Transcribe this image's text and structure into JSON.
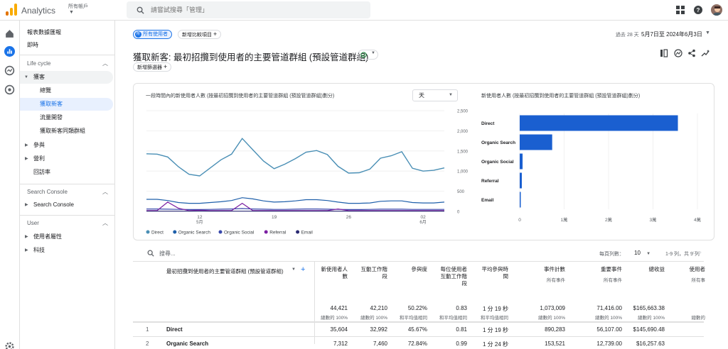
{
  "app": {
    "name": "Analytics",
    "account_label": "所有帳戶",
    "search_placeholder": "請嘗試搜尋「管理」"
  },
  "nav": {
    "items": [
      {
        "label": "報表數據匯報"
      },
      {
        "label": "即時"
      }
    ],
    "lifecycle": {
      "title": "Life cycle",
      "acquisition": "獲客",
      "acq_children": [
        "總覽",
        "獲取新客",
        "流量開發",
        "獲取新客同類群組"
      ],
      "engagement": "參與",
      "monetization": "營利",
      "retention": "回訪率"
    },
    "search_console": {
      "title": "Search Console",
      "item": "Search Console"
    },
    "user": {
      "title": "User",
      "items": [
        "使用者屬性",
        "科技"
      ]
    }
  },
  "toolbar": {
    "segment_chip": "所有使用者",
    "segment_avatar": "所",
    "add_compare": "新增比較項目",
    "add_filter": "新增篩選器",
    "date_label": "過去 28 天",
    "date_range": "5月7日至 2024年6月3日"
  },
  "page_title": "獲取新客: 最初招攬到使用者的主要管道群組 (預設管道群組)",
  "line_chart": {
    "title": "一段時間內的新使用者人數 (按最初招攬到使用者的主要管道群組 (預設管道群組)劃分)",
    "granularity": "天",
    "legend": [
      {
        "name": "Direct",
        "color": "#4a8fb5"
      },
      {
        "name": "Organic Search",
        "color": "#1e5faa"
      },
      {
        "name": "Organic Social",
        "color": "#3949ab"
      },
      {
        "name": "Referral",
        "color": "#7b1fa2"
      },
      {
        "name": "Email",
        "color": "#2a2a72"
      }
    ]
  },
  "bar_chart": {
    "title": "新使用者人數 (按最初招攬到使用者的主要管道群組 (預設管道群組)劃分)",
    "bar_color": "#1a5fd0"
  },
  "chart_data": [
    {
      "type": "line",
      "x_ticks": [
        {
          "label": "12",
          "sub": "5月"
        },
        {
          "label": "19",
          "sub": ""
        },
        {
          "label": "26",
          "sub": ""
        },
        {
          "label": "02",
          "sub": "6月"
        }
      ],
      "y_ticks": [
        "2,500",
        "2,000",
        "1,500",
        "1,000",
        "500",
        "0"
      ],
      "ylim": [
        0,
        2500
      ],
      "series": [
        {
          "name": "Direct",
          "values": [
            1430,
            1420,
            1350,
            1110,
            920,
            880,
            1080,
            1280,
            1420,
            1810,
            1530,
            1250,
            1060,
            1170,
            1310,
            1470,
            1510,
            1410,
            1120,
            950,
            960,
            1050,
            1320,
            1380,
            1480,
            1070,
            1000,
            1020,
            1080
          ]
        },
        {
          "name": "Organic Search",
          "values": [
            300,
            300,
            270,
            220,
            200,
            200,
            220,
            240,
            270,
            340,
            310,
            260,
            230,
            240,
            260,
            290,
            290,
            270,
            230,
            200,
            200,
            210,
            250,
            260,
            260,
            220,
            210,
            210,
            230
          ]
        },
        {
          "name": "Organic Social",
          "values": [
            60,
            60,
            55,
            50,
            45,
            45,
            50,
            55,
            60,
            70,
            60,
            55,
            50,
            50,
            55,
            60,
            60,
            55,
            50,
            45,
            45,
            50,
            55,
            55,
            55,
            50,
            50,
            50,
            50
          ]
        },
        {
          "name": "Referral",
          "values": [
            20,
            20,
            230,
            80,
            20,
            30,
            20,
            20,
            20,
            200,
            20,
            20,
            20,
            20,
            20,
            20,
            20,
            20,
            60,
            20,
            20,
            20,
            20,
            20,
            20,
            20,
            20,
            20,
            20
          ]
        },
        {
          "name": "Email",
          "values": [
            5,
            5,
            5,
            5,
            5,
            5,
            5,
            5,
            5,
            5,
            5,
            5,
            5,
            5,
            5,
            5,
            5,
            5,
            5,
            5,
            5,
            5,
            5,
            5,
            5,
            5,
            5,
            5,
            5
          ]
        }
      ]
    },
    {
      "type": "bar",
      "orientation": "horizontal",
      "categories": [
        "Direct",
        "Organic Search",
        "Organic Social",
        "Referral",
        "Email"
      ],
      "values": [
        35604,
        7312,
        650,
        480,
        240
      ],
      "x_ticks": [
        "0",
        "1萬",
        "2萬",
        "3萬",
        "4萬"
      ],
      "xlim": [
        0,
        40000
      ]
    }
  ],
  "table": {
    "search_placeholder": "搜尋...",
    "rows_per_page_label": "每頁列數：",
    "rows_per_page": "10",
    "pagination": "1-9 列，共 9 列",
    "dimension_header": "最初招攬到使用者的主要管道群組 (預設管道群組)",
    "columns": [
      {
        "header": "新使用者人數",
        "sub": "",
        "total": "44,421",
        "total_sub": "總數的 100%"
      },
      {
        "header": "互動工作階段",
        "sub": "",
        "total": "42,210",
        "total_sub": "總數的 100%"
      },
      {
        "header": "參與度",
        "sub": "",
        "total": "50.22%",
        "total_sub": "和平均值相同"
      },
      {
        "header": "每位使用者互動工作階段",
        "sub": "",
        "total": "0.83",
        "total_sub": "和平均值相同"
      },
      {
        "header": "平均參與時間",
        "sub": "",
        "total": "1 分 19 秒",
        "total_sub": "和平均值相同"
      },
      {
        "header": "事件計數",
        "sub": "所有事件",
        "total": "1,073,009",
        "total_sub": "總數的 100%"
      },
      {
        "header": "重要事件",
        "sub": "所有事件",
        "total": "71,416.00",
        "total_sub": "總數的 100%"
      },
      {
        "header": "總收益",
        "sub": "",
        "total": "$165,663.38",
        "total_sub": "總數的 100%"
      },
      {
        "header": "使用者",
        "sub": "所有事",
        "total": "",
        "total_sub": "總數的"
      }
    ],
    "rows": [
      {
        "index": "1",
        "name": "Direct",
        "cells": [
          "35,604",
          "32,992",
          "45.67%",
          "0.81",
          "1 分 19 秒",
          "890,283",
          "56,107.00",
          "$145,690.48",
          ""
        ]
      },
      {
        "index": "2",
        "name": "Organic Search",
        "cells": [
          "7,312",
          "7,460",
          "72.84%",
          "0.99",
          "1 分 24 秒",
          "153,521",
          "12,739.00",
          "$16,257.63",
          ""
        ]
      }
    ]
  },
  "colors": {
    "accent": "#1a73e8",
    "bar": "#1a5fd0"
  }
}
